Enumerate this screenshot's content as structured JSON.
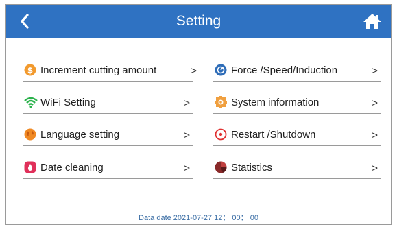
{
  "header": {
    "title": "Setting",
    "back_icon": "chevron-left-icon",
    "home_icon": "home-icon",
    "bar_color": "#2f72c2"
  },
  "menu": {
    "left": [
      {
        "label": "Increment cutting amount",
        "icon": "coin-icon",
        "icon_color": "#f29a2e",
        "chevron": ">"
      },
      {
        "label": "WiFi Setting",
        "icon": "wifi-icon",
        "icon_color": "#2bb24c",
        "chevron": ">"
      },
      {
        "label": "Language setting",
        "icon": "globe-icon",
        "icon_color": "#f08a24",
        "chevron": ">"
      },
      {
        "label": "Date cleaning",
        "icon": "drop-icon",
        "icon_color": "#e0305a",
        "chevron": ">"
      }
    ],
    "right": [
      {
        "label": "Force /Speed/Induction",
        "icon": "gauge-icon",
        "icon_color": "#2f6db8",
        "chevron": ">"
      },
      {
        "label": "System information",
        "icon": "gear-icon",
        "icon_color": "#f0a040",
        "chevron": ">"
      },
      {
        "label": "Restart /Shutdown",
        "icon": "power-icon",
        "icon_color": "#e03030",
        "chevron": ">"
      },
      {
        "label": "Statistics",
        "icon": "pie-chart-icon",
        "icon_color": "#8a2a2a",
        "chevron": ">"
      }
    ]
  },
  "footer": {
    "text": "Data date 2021-07-27 12： 00： 00"
  }
}
